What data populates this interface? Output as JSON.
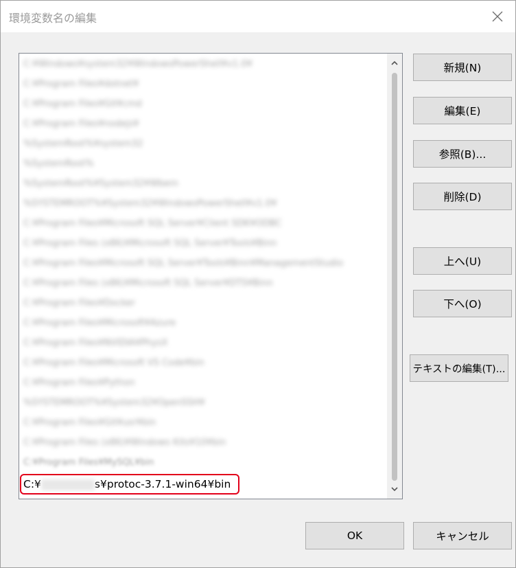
{
  "window": {
    "title": "環境変数名の編集"
  },
  "list": {
    "items_blurred": [
      "C:¥Windows¥system32¥WindowsPowerShell¥v1.0¥",
      "C:¥Program Files¥dotnet¥",
      "C:¥Program Files¥Git¥cmd",
      "C:¥Program Files¥nodejs¥",
      "%SystemRoot%¥system32",
      "%SystemRoot%",
      "%SystemRoot%¥System32¥Wbem",
      "%SYSTEMROOT%¥System32¥WindowsPowerShell¥v1.0¥",
      "C:¥Program Files¥Microsoft SQL Server¥Client SDK¥ODBC",
      "C:¥Program Files (x86)¥Microsoft SQL Server¥Tools¥Binn",
      "C:¥Program Files¥Microsoft SQL Server¥Tools¥Binn¥ManagementStudio",
      "C:¥Program Files (x86)¥Microsoft SQL Server¥DTS¥Binn",
      "C:¥Program Files¥Docker",
      "C:¥Program Files¥Microsoft¥Azure",
      "C:¥Program Files¥NVIDIA¥PhysX",
      "C:¥Program Files¥Microsoft VS Code¥bin",
      "C:¥Program Files¥Python",
      "%SYSTEMROOT%¥System32¥OpenSSH¥",
      "C:¥Program Files¥Git¥usr¥bin",
      "C:¥Program Files (x86)¥Windows Kits¥10¥bin",
      "C:¥Program Files¥MySQL¥bin"
    ],
    "selected_item_prefix": "C:¥",
    "selected_item_redacted_suffix": "s",
    "selected_item_rest": "¥protoc-3.7.1-win64¥bin"
  },
  "buttons": {
    "new": "新規(N)",
    "edit": "編集(E)",
    "browse": "参照(B)...",
    "delete": "削除(D)",
    "up": "上へ(U)",
    "down": "下へ(O)",
    "edit_text": "テキストの編集(T)...",
    "ok": "OK",
    "cancel": "キャンセル"
  },
  "colors": {
    "highlight": "#e2001a",
    "button_bg": "#e1e1e1",
    "dialog_bg": "#f0f0f0"
  },
  "icons": {
    "close": "close-icon",
    "scroll_up": "chevron-up-icon",
    "scroll_down": "chevron-down-icon"
  }
}
